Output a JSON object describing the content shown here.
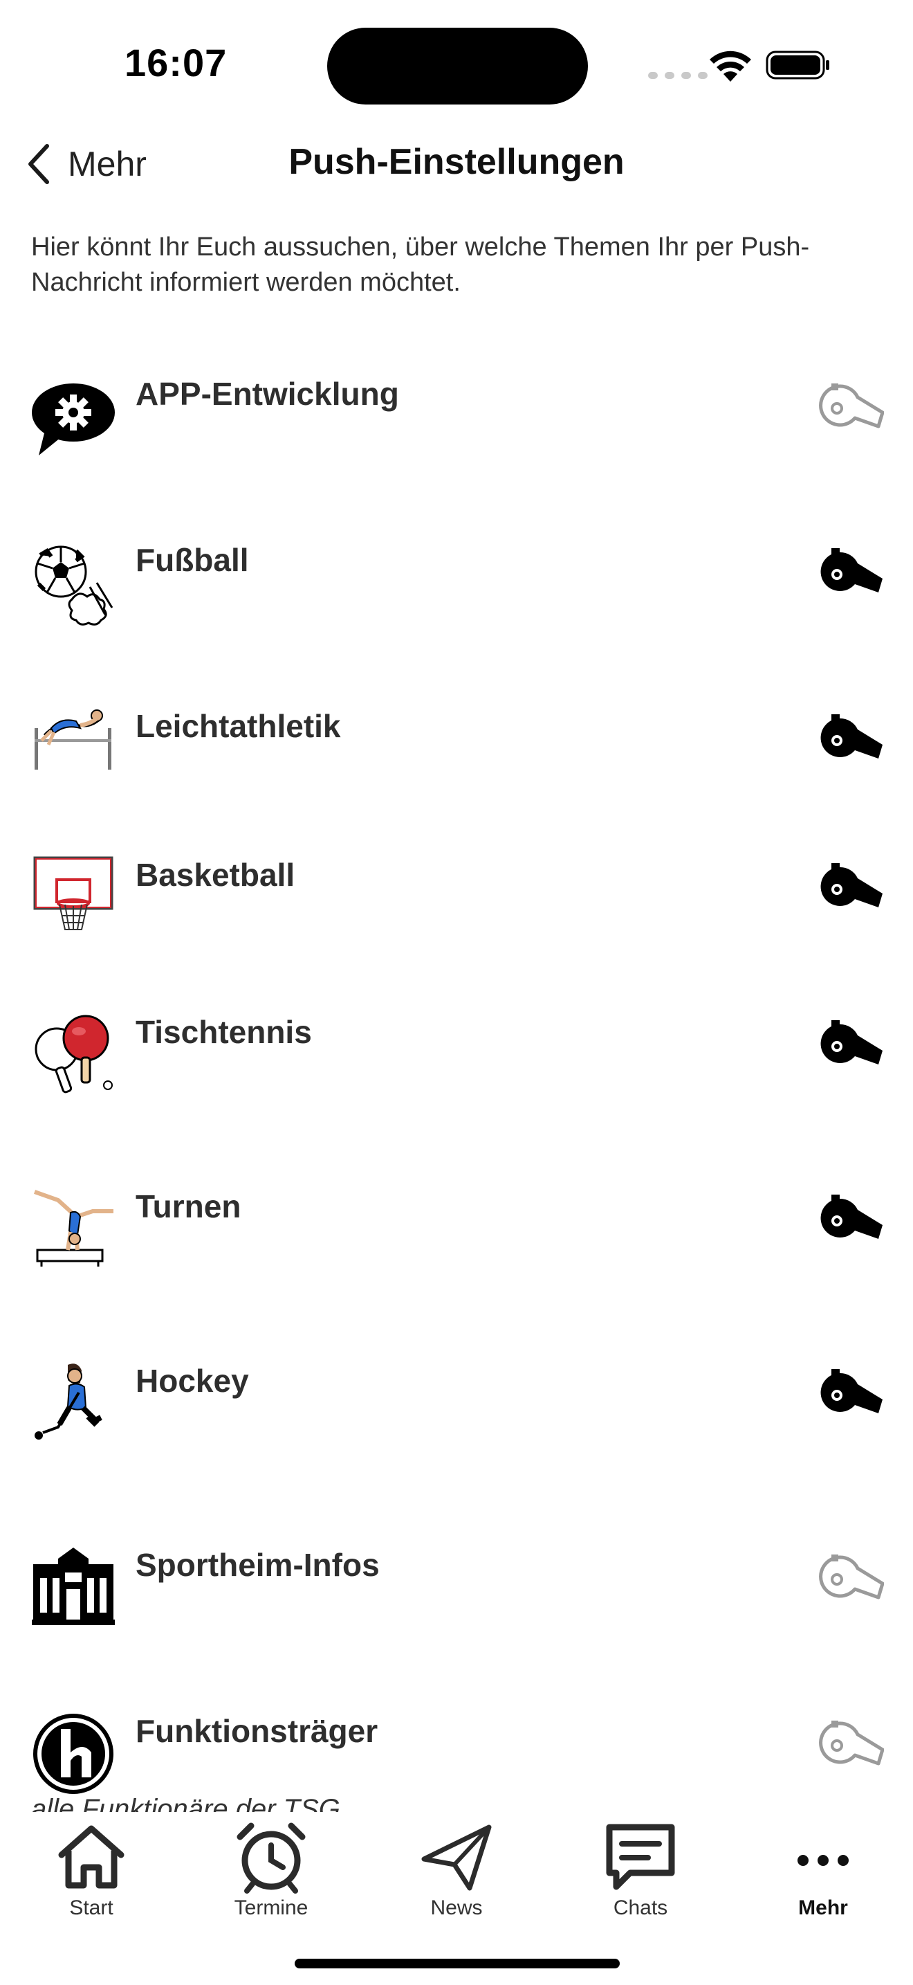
{
  "status_bar": {
    "time": "16:07"
  },
  "nav": {
    "back_label": "Mehr",
    "title": "Push-Einstellungen"
  },
  "intro_text": "Hier könnt Ihr Euch aussuchen, über welche Themen Ihr per Push-Nachricht informiert werden möchtet.",
  "topics": [
    {
      "label": "APP-Entwicklung",
      "icon": "gear-speech-bubble-icon",
      "enabled": false
    },
    {
      "label": "Fußball",
      "icon": "soccer-ball-icon",
      "enabled": true
    },
    {
      "label": "Leichtathletik",
      "icon": "high-jump-icon",
      "enabled": true
    },
    {
      "label": "Basketball",
      "icon": "basketball-hoop-icon",
      "enabled": true
    },
    {
      "label": "Tischtennis",
      "icon": "ping-pong-paddles-icon",
      "enabled": true
    },
    {
      "label": "Turnen",
      "icon": "gymnast-icon",
      "enabled": true
    },
    {
      "label": "Hockey",
      "icon": "hockey-player-icon",
      "enabled": true
    },
    {
      "label": "Sportheim-Infos",
      "icon": "building-icon",
      "enabled": false
    },
    {
      "label": "Funktionsträger",
      "icon": "club-logo-icon",
      "enabled": false,
      "subtitle": "alle Funktionäre der TSG"
    }
  ],
  "tab_bar": {
    "items": [
      {
        "label": "Start",
        "icon": "house-icon"
      },
      {
        "label": "Termine",
        "icon": "alarm-clock-icon"
      },
      {
        "label": "News",
        "icon": "paper-plane-icon"
      },
      {
        "label": "Chats",
        "icon": "chat-bubble-icon"
      },
      {
        "label": "Mehr",
        "icon": "more-dots-icon",
        "active": true
      }
    ]
  },
  "colors": {
    "whistle_on": "#000000",
    "whistle_off": "#9a9a9a",
    "text": "#2e2e2e"
  }
}
